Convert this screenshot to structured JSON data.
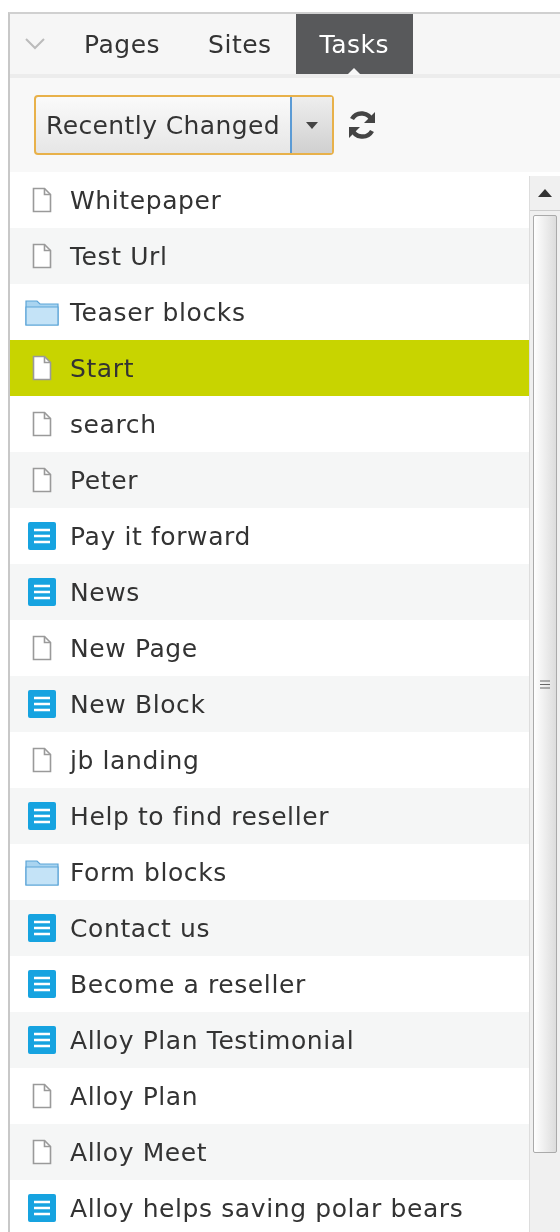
{
  "tabs": [
    {
      "label": "Pages",
      "selected": false
    },
    {
      "label": "Sites",
      "selected": false
    },
    {
      "label": "Tasks",
      "selected": true
    }
  ],
  "filter": {
    "value": "Recently Changed"
  },
  "items": [
    {
      "label": "Whitepaper",
      "kind": "page",
      "selected": false
    },
    {
      "label": "Test Url",
      "kind": "page",
      "selected": false
    },
    {
      "label": "Teaser blocks",
      "kind": "folder",
      "selected": false
    },
    {
      "label": "Start",
      "kind": "page",
      "selected": true
    },
    {
      "label": "search",
      "kind": "page",
      "selected": false
    },
    {
      "label": "Peter",
      "kind": "page",
      "selected": false
    },
    {
      "label": "Pay it forward",
      "kind": "block",
      "selected": false
    },
    {
      "label": "News",
      "kind": "block",
      "selected": false
    },
    {
      "label": "New Page",
      "kind": "page",
      "selected": false
    },
    {
      "label": "New Block",
      "kind": "block",
      "selected": false
    },
    {
      "label": "jb landing",
      "kind": "page",
      "selected": false
    },
    {
      "label": "Help to find reseller",
      "kind": "block",
      "selected": false
    },
    {
      "label": "Form blocks",
      "kind": "folder",
      "selected": false
    },
    {
      "label": "Contact us",
      "kind": "block",
      "selected": false
    },
    {
      "label": "Become a reseller",
      "kind": "block",
      "selected": false
    },
    {
      "label": "Alloy Plan Testimonial",
      "kind": "block",
      "selected": false
    },
    {
      "label": "Alloy Plan",
      "kind": "page",
      "selected": false
    },
    {
      "label": "Alloy Meet",
      "kind": "page",
      "selected": false
    },
    {
      "label": "Alloy helps saving polar bears",
      "kind": "block",
      "selected": false
    }
  ]
}
